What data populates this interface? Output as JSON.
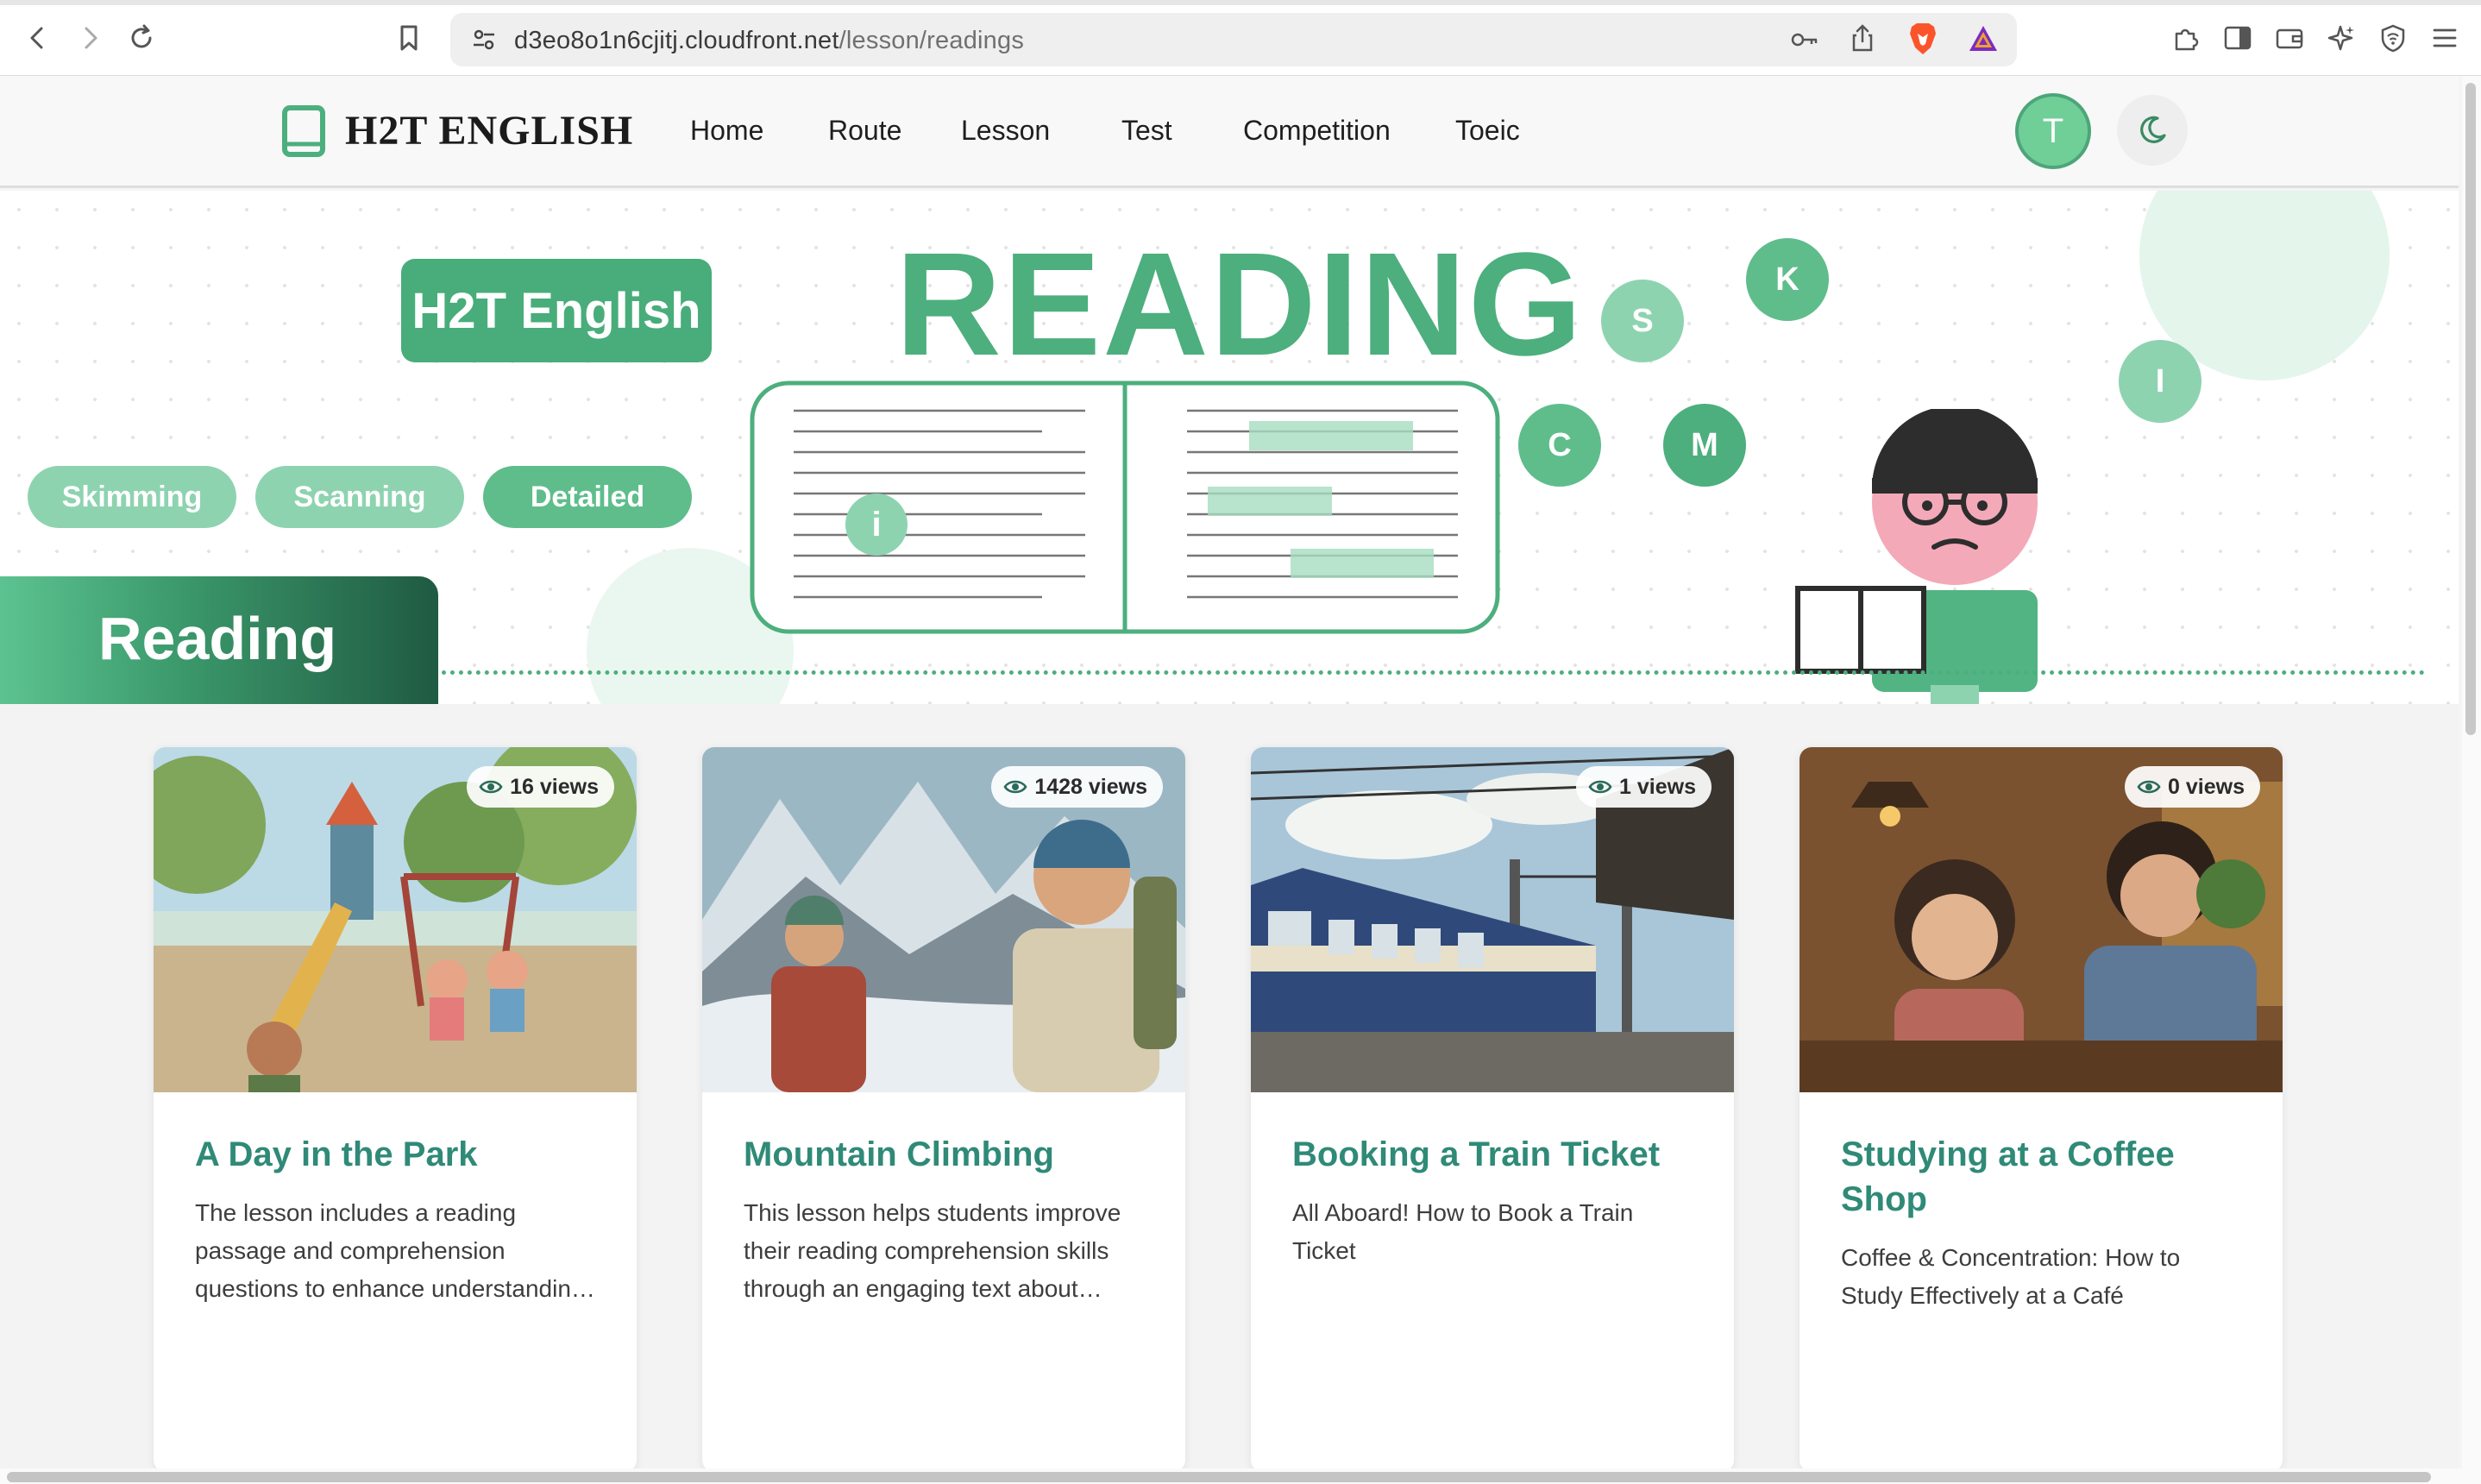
{
  "browser": {
    "url_host": "d3eo8o1n6cjitj.cloudfront.net",
    "url_path": "/lesson/readings",
    "icons": [
      "back-icon",
      "forward-icon",
      "reload-icon",
      "bookmark-icon",
      "site-settings-icon",
      "key-icon",
      "share-icon",
      "brave-shield-icon",
      "brave-rewards-icon",
      "extensions-icon",
      "sidebar-icon",
      "wallet-icon",
      "leo-ai-icon",
      "vpn-icon",
      "menu-icon"
    ]
  },
  "site": {
    "logo_text": "H2T ENGLISH",
    "nav": [
      "Home",
      "Route",
      "Lesson",
      "Test",
      "Competition",
      "Toeic"
    ],
    "avatar_letter": "T"
  },
  "hero": {
    "badge": "H2T English",
    "title": "READING",
    "pills": [
      "Skimming",
      "Scanning",
      "Detailed"
    ],
    "floating_letters": [
      "S",
      "K",
      "I",
      "C",
      "M",
      "i"
    ],
    "section_tab": "Reading",
    "colors": {
      "primary": "#4caf7d",
      "light": "#8ed3b0",
      "dark": "#1f5a42"
    }
  },
  "lessons": [
    {
      "title": "A Day in the Park",
      "views": "16 views",
      "description": "The lesson includes a reading passage and comprehension questions to enhance understanding of the text."
    },
    {
      "title": "Mountain Climbing",
      "views": "1428 views",
      "description": "This lesson helps students improve their reading comprehension skills through an engaging text about mountain climbing."
    },
    {
      "title": "Booking a Train Ticket",
      "views": "1 views",
      "description": "All Aboard! How to Book a Train Ticket"
    },
    {
      "title": "Studying at a Coffee Shop",
      "views": "0 views",
      "description": "Coffee & Concentration: How to Study Effectively at a Café"
    }
  ]
}
